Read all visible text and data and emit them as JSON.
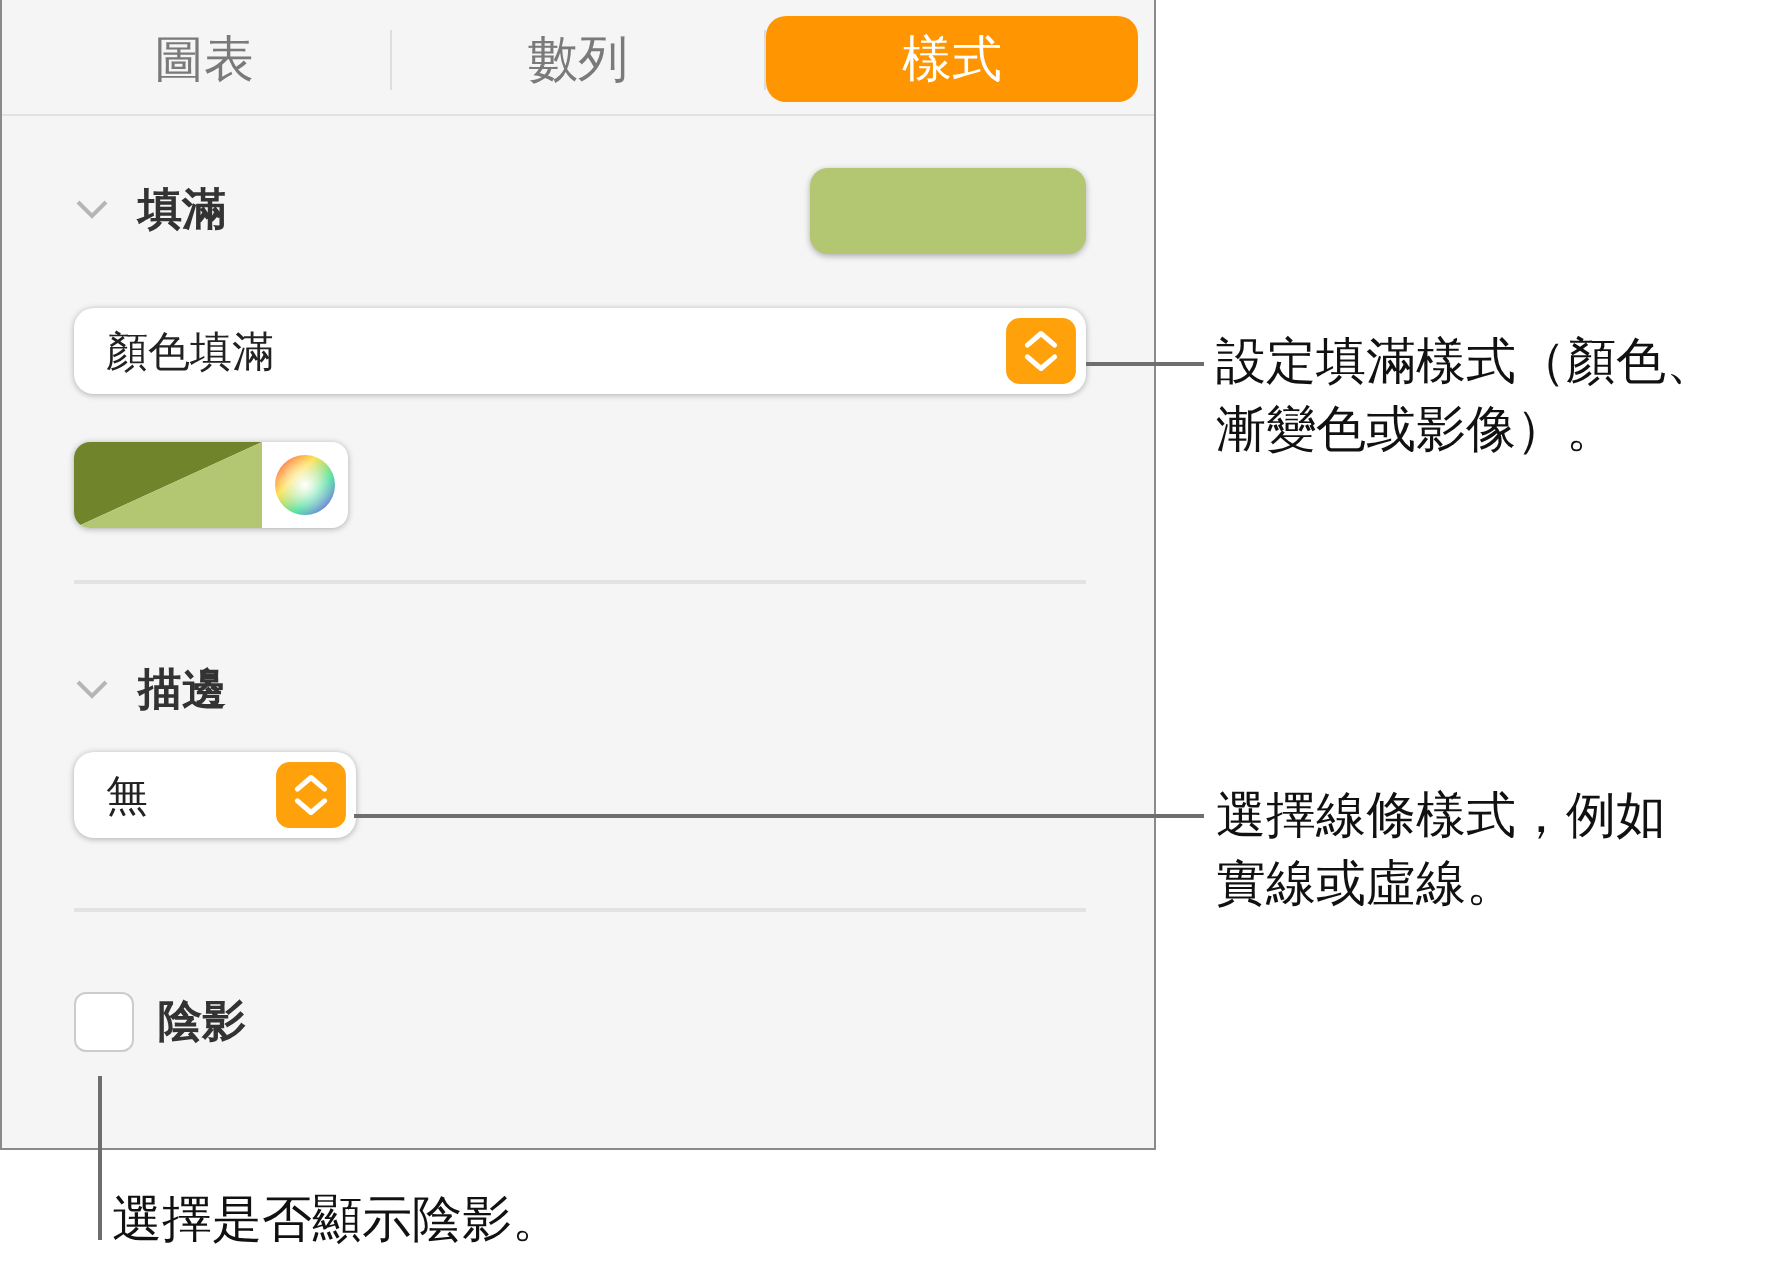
{
  "tabs": [
    {
      "label": "圖表",
      "selected": false
    },
    {
      "label": "數列",
      "selected": false
    },
    {
      "label": "樣式",
      "selected": true
    }
  ],
  "fill": {
    "title": "填滿",
    "expanded": true,
    "popup_value": "顏色填滿"
  },
  "stroke": {
    "title": "描邊",
    "expanded": true,
    "popup_value": "無"
  },
  "shadow": {
    "label": "陰影",
    "checked": false
  },
  "callouts": [
    {
      "text": "設定填滿樣式（顏色、漸變色或影像）。"
    },
    {
      "text": "選擇線條樣式，例如實線或虛線。"
    },
    {
      "text": "選擇是否顯示陰影。"
    }
  ]
}
